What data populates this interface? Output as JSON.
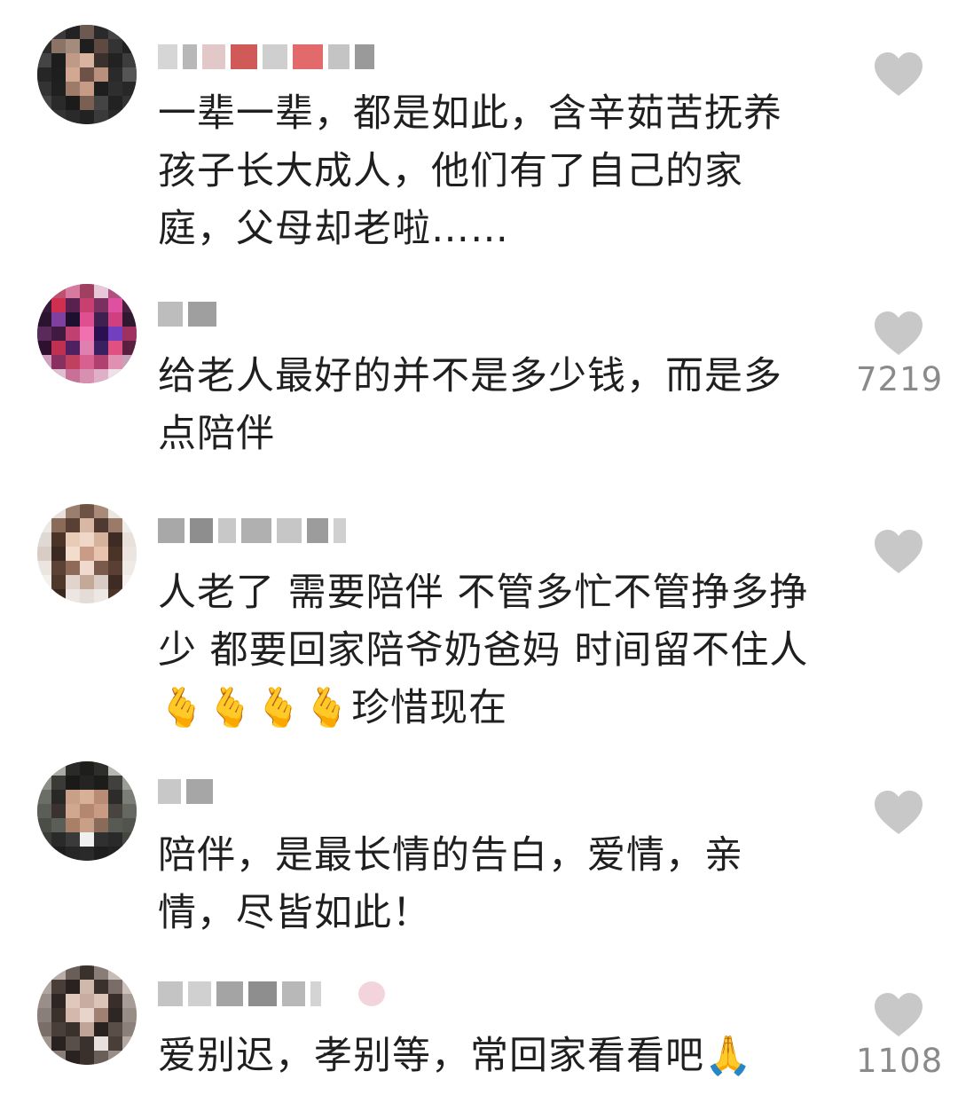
{
  "colors": {
    "heart": "#c8c8c8",
    "count": "#8a8a8a",
    "text": "#1f1f1f"
  },
  "comments": [
    {
      "text": "一辈一辈，都是如此，含辛茹苦抚养\n孩子长大成人，他们有了自己的家\n庭，父母却老啦……",
      "likes": ""
    },
    {
      "text": "给老人最好的并不是多少钱，而是多\n点陪伴",
      "likes": "7219"
    },
    {
      "text": "人老了 需要陪伴 不管多忙不管挣多挣\n少 都要回家陪爷奶爸妈 时间留不住人\n🫰🫰🫰🫰珍惜现在",
      "likes": ""
    },
    {
      "text": "陪伴，是最长情的告白，爱情，亲\n情，尽皆如此！",
      "likes": ""
    },
    {
      "text": "爱别迟，孝别等，常回家看看吧🙏",
      "likes": "1108"
    }
  ]
}
